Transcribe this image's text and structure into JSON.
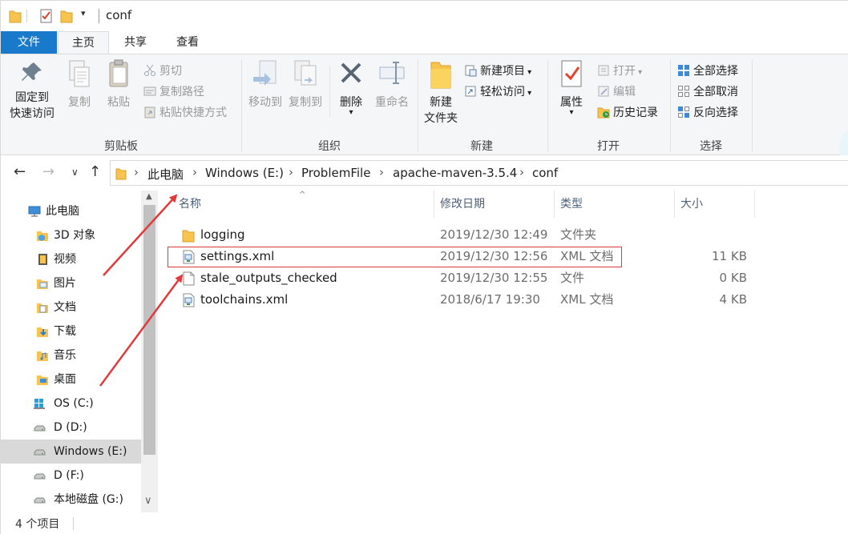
{
  "window": {
    "title": "conf"
  },
  "ribbon_tabs": [
    {
      "label": "文件"
    },
    {
      "label": "主页"
    },
    {
      "label": "共享"
    },
    {
      "label": "查看"
    }
  ],
  "ribbon": {
    "clipboard": {
      "pin_label": "固定到\n快速访问",
      "pin_line1": "固定到",
      "pin_line2": "快速访问",
      "copy_label": "复制",
      "paste_label": "粘贴",
      "cut_label": "剪切",
      "copy_path_label": "复制路径",
      "paste_shortcut_label": "粘贴快捷方式",
      "group_label": "剪贴板"
    },
    "organize": {
      "move_to_label": "移动到",
      "copy_to_label": "复制到",
      "delete_label": "删除",
      "rename_label": "重命名",
      "group_label": "组织"
    },
    "new": {
      "new_folder_line1": "新建",
      "new_folder_line2": "文件夹",
      "new_item_label": "新建项目",
      "easy_access_label": "轻松访问",
      "group_label": "新建"
    },
    "open": {
      "properties_label": "属性",
      "open_label": "打开",
      "edit_label": "编辑",
      "history_label": "历史记录",
      "group_label": "打开"
    },
    "select": {
      "select_all_label": "全部选择",
      "select_none_label": "全部取消",
      "invert_label": "反向选择",
      "group_label": "选择"
    }
  },
  "breadcrumb": [
    {
      "label": "此电脑"
    },
    {
      "label": "Windows (E:)"
    },
    {
      "label": "ProblemFile"
    },
    {
      "label": "apache-maven-3.5.4"
    },
    {
      "label": "conf"
    }
  ],
  "nav_pane": {
    "items": [
      {
        "label": "此电脑",
        "icon": "pc-icon"
      },
      {
        "label": "3D 对象",
        "icon": "3d-objects-icon"
      },
      {
        "label": "视频",
        "icon": "video-folder-icon"
      },
      {
        "label": "图片",
        "icon": "pictures-folder-icon"
      },
      {
        "label": "文档",
        "icon": "documents-folder-icon"
      },
      {
        "label": "下载",
        "icon": "downloads-folder-icon"
      },
      {
        "label": "音乐",
        "icon": "music-folder-icon"
      },
      {
        "label": "桌面",
        "icon": "desktop-folder-icon"
      },
      {
        "label": "OS (C:)",
        "icon": "windows-drive-icon"
      },
      {
        "label": "D (D:)",
        "icon": "drive-icon"
      },
      {
        "label": "Windows (E:)",
        "icon": "drive-icon",
        "selected": true
      },
      {
        "label": "D (F:)",
        "icon": "drive-icon"
      },
      {
        "label": "本地磁盘 (G:)",
        "icon": "drive-icon"
      }
    ]
  },
  "file_list": {
    "columns": {
      "name": "名称",
      "date": "修改日期",
      "type": "类型",
      "size": "大小"
    },
    "rows": [
      {
        "name": "logging",
        "date": "2019/12/30 12:49",
        "type": "文件夹",
        "size": "",
        "icon": "folder-icon"
      },
      {
        "name": "settings.xml",
        "date": "2019/12/30 12:56",
        "type": "XML 文档",
        "size": "11 KB",
        "icon": "xml-file-icon"
      },
      {
        "name": "stale_outputs_checked",
        "date": "2019/12/30 12:55",
        "type": "文件",
        "size": "0 KB",
        "icon": "blank-file-icon"
      },
      {
        "name": "toolchains.xml",
        "date": "2018/6/17 19:30",
        "type": "XML 文档",
        "size": "4 KB",
        "icon": "xml-file-icon"
      }
    ]
  },
  "status_bar": {
    "item_count": "4 个项目"
  },
  "colors": {
    "accent": "#1979ca",
    "annotation": "#e23a3a",
    "folder": "#f8c44f"
  }
}
